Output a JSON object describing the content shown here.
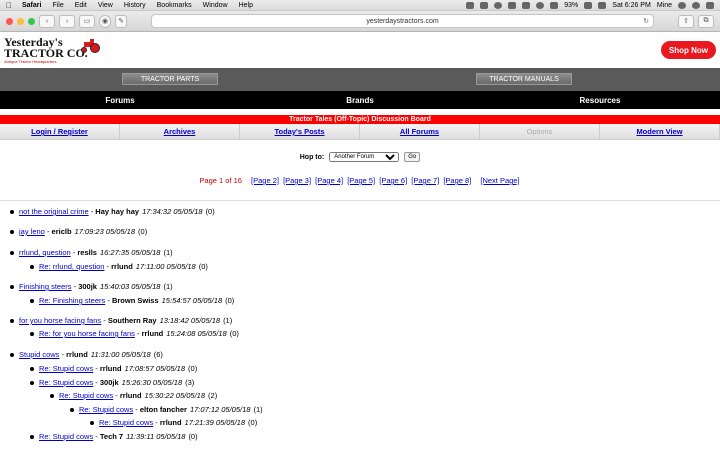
{
  "menubar": {
    "items": [
      "Safari",
      "File",
      "Edit",
      "View",
      "History",
      "Bookmarks",
      "Window",
      "Help"
    ],
    "battery": "93%",
    "clock": "Sat 6:26 PM",
    "user": "Mine"
  },
  "browser": {
    "url": "yesterdaystractors.com"
  },
  "site": {
    "logo_line1": "Yesterday's",
    "logo_line2": "TRACTOR CO.",
    "logo_tagline": "Antique Tractor Headquarters",
    "shop_now": "Shop Now",
    "tab_parts": "TRACTOR PARTS",
    "tab_manuals": "TRACTOR MANUALS",
    "nav": [
      "Forums",
      "Brands",
      "Resources"
    ],
    "board_title": "Tractor Tales (Off-Topic) Discussion Board",
    "links": [
      "Login / Register",
      "Archives",
      "Today's Posts",
      "All Forums",
      "Options",
      "Modern View"
    ],
    "hop_label": "Hop to:",
    "hop_value": "Another Forum",
    "go_label": "Go",
    "page_current": "Page 1 of 16",
    "pages": [
      "[Page 2]",
      "[Page 3]",
      "[Page 4]",
      "[Page 5]",
      "[Page 6]",
      "[Page 7]",
      "[Page 8]",
      "[Next Page]"
    ]
  },
  "threads": [
    {
      "title": "not the original crime",
      "author": "Hay hay hay",
      "time": "17:34:32 05/05/18",
      "replies": "(0)",
      "depth": 0
    },
    {
      "title": "jay leno",
      "author": "ericlb",
      "time": "17:09:23 05/05/18",
      "replies": "(0)",
      "depth": 0
    },
    {
      "title": "rrlund, question",
      "author": "reslls",
      "time": "16:27:35 05/05/18",
      "replies": "(1)",
      "depth": 0
    },
    {
      "title": "Re: rrlund, question",
      "author": "rrlund",
      "time": "17:11:00 05/05/18",
      "replies": "(0)",
      "depth": 1
    },
    {
      "title": "Finishing steers",
      "author": "300jk",
      "time": "15:40:03 05/05/18",
      "replies": "(1)",
      "depth": 0
    },
    {
      "title": "Re: Finishing steers",
      "author": "Brown Swiss",
      "time": "15:54:57 05/05/18",
      "replies": "(0)",
      "depth": 1
    },
    {
      "title": "for you horse facing fans",
      "author": "Southern Ray",
      "time": "13:18:42 05/05/18",
      "replies": "(1)",
      "depth": 0
    },
    {
      "title": "Re: for you horse facing fans",
      "author": "rrlund",
      "time": "15:24:08 05/05/18",
      "replies": "(0)",
      "depth": 1
    },
    {
      "title": "Stupid cows",
      "author": "rrlund",
      "time": "11:31:00 05/05/18",
      "replies": "(6)",
      "depth": 0
    },
    {
      "title": "Re: Stupid cows",
      "author": "rrlund",
      "time": "17:08:57 05/05/18",
      "replies": "(0)",
      "depth": 1
    },
    {
      "title": "Re: Stupid cows",
      "author": "300jk",
      "time": "15:26:30 05/05/18",
      "replies": "(3)",
      "depth": 1
    },
    {
      "title": "Re: Stupid cows",
      "author": "rrlund",
      "time": "15:30:22 05/05/18",
      "replies": "(2)",
      "depth": 2
    },
    {
      "title": "Re: Stupid cows",
      "author": "elton fancher",
      "time": "17:07:12 05/05/18",
      "replies": "(1)",
      "depth": 3
    },
    {
      "title": "Re: Stupid cows",
      "author": "rrlund",
      "time": "17:21:39 05/05/18",
      "replies": "(0)",
      "depth": 4
    },
    {
      "title": "Re: Stupid cows",
      "author": "Tech 7",
      "time": "11:39:11 05/05/18",
      "replies": "(0)",
      "depth": 1
    }
  ]
}
